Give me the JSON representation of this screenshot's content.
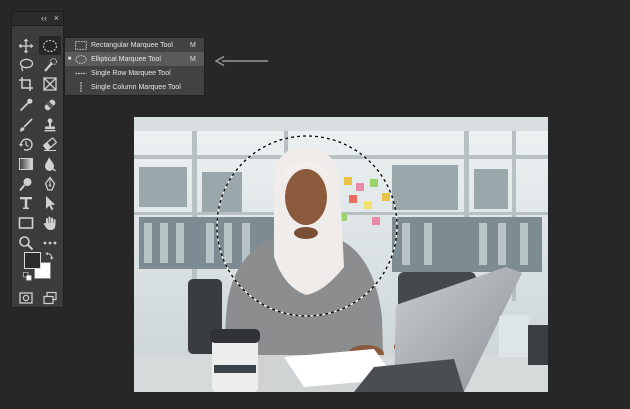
{
  "panel": {
    "collapse_label": "‹‹",
    "close_label": "×"
  },
  "tools": [
    {
      "name": "move-icon"
    },
    {
      "name": "elliptical-marquee-icon"
    },
    {
      "name": "lasso-icon"
    },
    {
      "name": "quick-selection-icon"
    },
    {
      "name": "crop-icon"
    },
    {
      "name": "frame-icon"
    },
    {
      "name": "eyedropper-icon"
    },
    {
      "name": "healing-brush-icon"
    },
    {
      "name": "brush-icon"
    },
    {
      "name": "clone-stamp-icon"
    },
    {
      "name": "history-brush-icon"
    },
    {
      "name": "eraser-icon"
    },
    {
      "name": "gradient-icon"
    },
    {
      "name": "blur-icon"
    },
    {
      "name": "dodge-icon"
    },
    {
      "name": "pen-icon"
    },
    {
      "name": "type-icon"
    },
    {
      "name": "path-selection-icon"
    },
    {
      "name": "rectangle-icon"
    },
    {
      "name": "hand-icon"
    },
    {
      "name": "zoom-icon"
    },
    {
      "name": "more-tools-icon"
    }
  ],
  "colors": {
    "foreground": "#2b2b2b",
    "background": "#ffffff"
  },
  "menu": {
    "items": [
      {
        "label": "Rectangular Marquee Tool",
        "key": "M",
        "selected": false,
        "current": false,
        "icon": "rectangular-marquee-icon"
      },
      {
        "label": "Elliptical Marquee Tool",
        "key": "M",
        "selected": true,
        "current": true,
        "icon": "elliptical-marquee-icon"
      },
      {
        "label": "Single Row Marquee Tool",
        "key": "",
        "selected": false,
        "current": false,
        "icon": "single-row-marquee-icon"
      },
      {
        "label": "Single Column Marquee Tool",
        "key": "",
        "selected": false,
        "current": false,
        "icon": "single-column-marquee-icon"
      }
    ],
    "current_marker": "■"
  }
}
